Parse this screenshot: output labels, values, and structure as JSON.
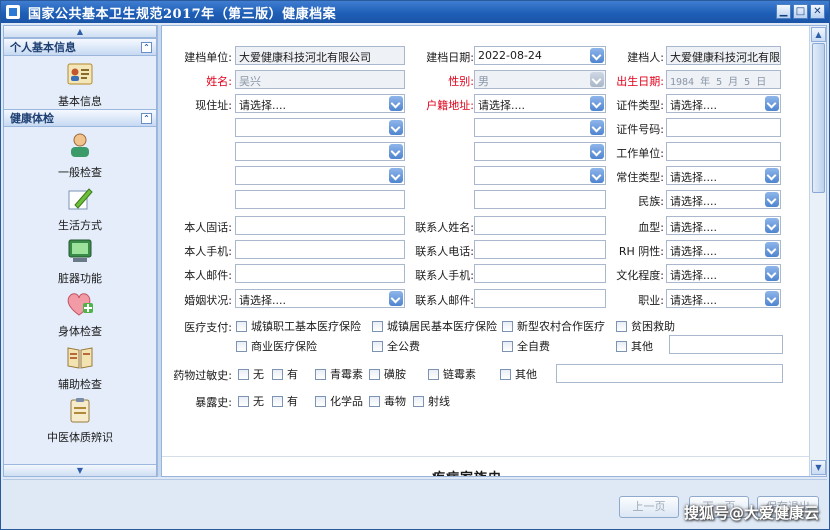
{
  "window": {
    "title": "国家公共基本卫生规范2017年（第三版）健康档案",
    "buttons": [
      "▁",
      "□",
      "✕"
    ]
  },
  "sidebar": {
    "groups": [
      {
        "title": "个人基本信息",
        "items": [
          {
            "label": "基本信息",
            "icon": "profile-card-icon"
          }
        ]
      },
      {
        "title": "健康体检",
        "items": [
          {
            "label": "一般检查",
            "icon": "person-icon"
          },
          {
            "label": "生活方式",
            "icon": "pencil-icon"
          },
          {
            "label": "脏器功能",
            "icon": "monitor-icon"
          },
          {
            "label": "身体检查",
            "icon": "heart-plus-icon"
          },
          {
            "label": "辅助检查",
            "icon": "book-icon"
          },
          {
            "label": "中医体质辨识",
            "icon": "clipboard-icon"
          }
        ]
      }
    ]
  },
  "form": {
    "labels": {
      "build_unit": "建档单位:",
      "build_date": "建档日期:",
      "builder": "建档人:",
      "name": "姓名:",
      "gender": "性别:",
      "birth": "出生日期:",
      "address": "现住址:",
      "hukou": "户籍地址:",
      "id_type": "证件类型:",
      "id_no": "证件号码:",
      "work_unit": "工作单位:",
      "residence_type": "常住类型:",
      "ethnic": "民族:",
      "phone": "本人固话:",
      "contact_name": "联系人姓名:",
      "blood": "血型:",
      "mobile": "本人手机:",
      "contact_phone": "联系人电话:",
      "rh": "RH 阴性:",
      "email": "本人邮件:",
      "contact_mobile": "联系人手机:",
      "education": "文化程度:",
      "marital": "婚姻状况:",
      "contact_email": "联系人邮件:",
      "job": "职业:",
      "pay": "医疗支付:",
      "allergy": "药物过敏史:",
      "exposure": "暴露史:"
    },
    "values": {
      "build_unit": "大爱健康科技河北有限公司",
      "build_date": "2022-08-24",
      "builder": "大爱健康科技河北有限",
      "name": "吴兴",
      "gender": "男",
      "birth": "1984 年  5 月  5 日",
      "select_placeholder": "请选择...."
    },
    "payment_options": [
      "城镇职工基本医疗保险",
      "城镇居民基本医疗保险",
      "新型农村合作医疗",
      "贫困救助",
      "商业医疗保险",
      "全公费",
      "全自费",
      "其他"
    ],
    "allergy_options": [
      "无",
      "有",
      "青霉素",
      "磺胺",
      "链霉素",
      "其他"
    ],
    "exposure_options": [
      "无",
      "有",
      "化学品",
      "毒物",
      "射线"
    ],
    "next_section": "疾病家族史"
  },
  "buttons": {
    "prev": "上一页",
    "next": "下一页",
    "save": "保存退出"
  },
  "watermark": "搜狐号@大爱健康云",
  "colors": {
    "title_bar": "#1f5fb8",
    "required_label": "#e0001a",
    "accent": "#4f84cf"
  }
}
